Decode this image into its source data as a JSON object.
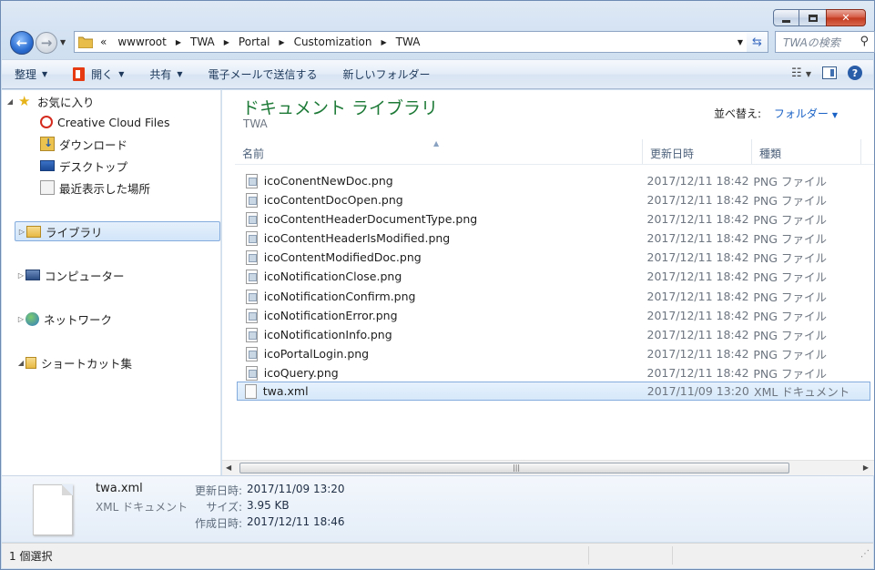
{
  "address": {
    "overflow": "«",
    "crumbs": [
      "wwwroot",
      "TWA",
      "Portal",
      "Customization",
      "TWA"
    ]
  },
  "search": {
    "placeholder": "TWAの検索"
  },
  "toolbar": {
    "organize": "整理",
    "open": "開く",
    "share": "共有",
    "email": "電子メールで送信する",
    "new_folder": "新しいフォルダー"
  },
  "navpane": {
    "favorites": "お気に入り",
    "creative_cloud": "Creative Cloud Files",
    "downloads": "ダウンロード",
    "desktop": "デスクトップ",
    "recent": "最近表示した場所",
    "libraries": "ライブラリ",
    "computer": "コンピューター",
    "network": "ネットワーク",
    "shortcuts": "ショートカット集"
  },
  "library": {
    "title": "ドキュメント ライブラリ",
    "subtitle": "TWA",
    "arrange_label": "並べ替え:",
    "arrange_value": "フォルダー"
  },
  "columns": {
    "name": "名前",
    "date": "更新日時",
    "type": "種類"
  },
  "files": [
    {
      "name": "icoConentNewDoc.png",
      "date": "2017/12/11 18:42",
      "type": "PNG ファイル"
    },
    {
      "name": "icoContentDocOpen.png",
      "date": "2017/12/11 18:42",
      "type": "PNG ファイル"
    },
    {
      "name": "icoContentHeaderDocumentType.png",
      "date": "2017/12/11 18:42",
      "type": "PNG ファイル"
    },
    {
      "name": "icoContentHeaderIsModified.png",
      "date": "2017/12/11 18:42",
      "type": "PNG ファイル"
    },
    {
      "name": "icoContentModifiedDoc.png",
      "date": "2017/12/11 18:42",
      "type": "PNG ファイル"
    },
    {
      "name": "icoNotificationClose.png",
      "date": "2017/12/11 18:42",
      "type": "PNG ファイル"
    },
    {
      "name": "icoNotificationConfirm.png",
      "date": "2017/12/11 18:42",
      "type": "PNG ファイル"
    },
    {
      "name": "icoNotificationError.png",
      "date": "2017/12/11 18:42",
      "type": "PNG ファイル"
    },
    {
      "name": "icoNotificationInfo.png",
      "date": "2017/12/11 18:42",
      "type": "PNG ファイル"
    },
    {
      "name": "icoPortalLogin.png",
      "date": "2017/12/11 18:42",
      "type": "PNG ファイル"
    },
    {
      "name": "icoQuery.png",
      "date": "2017/12/11 18:42",
      "type": "PNG ファイル"
    },
    {
      "name": "twa.xml",
      "date": "2017/11/09 13:20",
      "type": "XML ドキュメント"
    }
  ],
  "details": {
    "name": "twa.xml",
    "type": "XML ドキュメント",
    "modified_label": "更新日時:",
    "modified_value": "2017/11/09 13:20",
    "size_label": "サイズ:",
    "size_value": "3.95 KB",
    "created_label": "作成日時:",
    "created_value": "2017/12/11 18:46"
  },
  "status": {
    "selection": "1 個選択"
  }
}
